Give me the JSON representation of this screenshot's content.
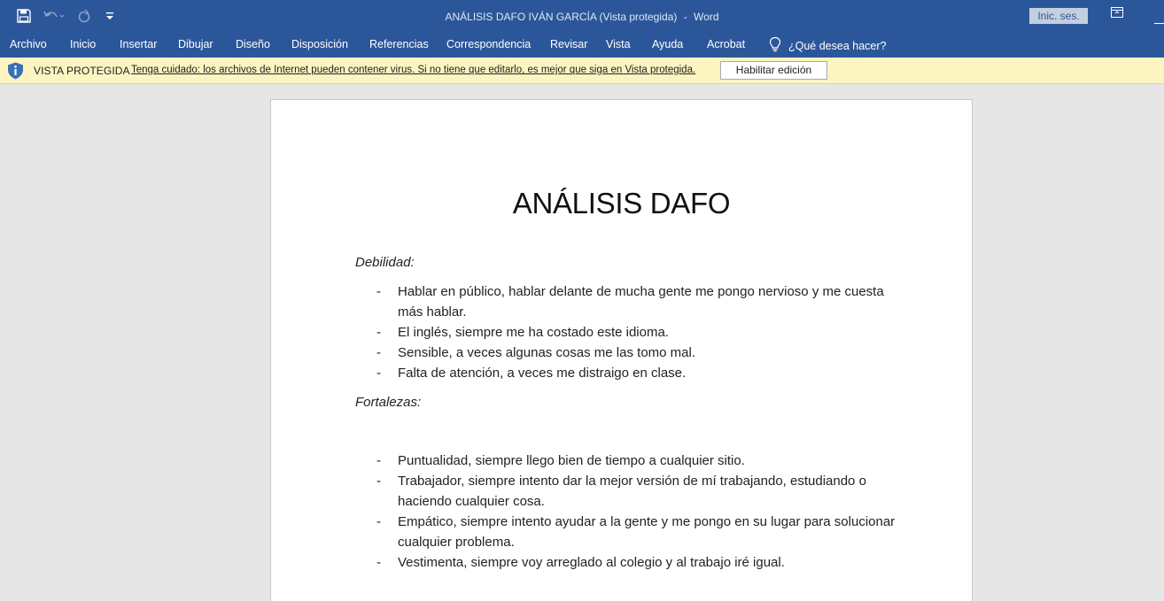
{
  "titlebar": {
    "doc_title": "ANÁLISIS DAFO IVÁN GARCÍA (Vista protegida)",
    "separator": "-",
    "app_name": "Word",
    "signin_label": "Inic. ses."
  },
  "menu": {
    "items": [
      "Archivo",
      "Inicio",
      "Insertar",
      "Dibujar",
      "Diseño",
      "Disposición",
      "Referencias",
      "Correspondencia",
      "Revisar",
      "Vista",
      "Ayuda",
      "Acrobat"
    ],
    "tellme": "¿Qué desea hacer?"
  },
  "protected_view": {
    "title": "VISTA PROTEGIDA",
    "message": "Tenga cuidado: los archivos de Internet pueden contener virus. Si no tiene que editarlo, es mejor que siga en Vista protegida.",
    "button": "Habilitar edición"
  },
  "document": {
    "title": "ANÁLISIS DAFO",
    "sections": [
      {
        "heading": "Debilidad:",
        "items": [
          "Hablar en público, hablar delante de mucha gente me pongo nervioso y me cuesta más hablar.",
          "El inglés, siempre me ha costado este idioma.",
          "Sensible, a veces algunas cosas me las tomo mal.",
          "Falta de atención, a veces me distraigo en clase."
        ]
      },
      {
        "heading": "Fortalezas:",
        "items": [
          "Puntualidad, siempre llego bien de tiempo a cualquier sitio.",
          "Trabajador, siempre intento dar la mejor versión de mí trabajando, estudiando o haciendo cualquier cosa.",
          "Empático, siempre intento ayudar a la gente y me pongo en su lugar para solucionar cualquier problema.",
          "Vestimenta, siempre voy arreglado al colegio y al trabajo iré igual."
        ]
      }
    ],
    "bullet": "-"
  },
  "icons": {
    "save": "save-icon",
    "undo": "undo-icon",
    "redo": "redo-icon",
    "customize": "customize-qat-icon",
    "ribbon_display": "ribbon-display-icon",
    "minimize": "minimize-icon",
    "lightbulb": "lightbulb-icon",
    "shield": "shield-info-icon"
  },
  "colors": {
    "accent": "#2b579a",
    "protected_bar": "#fdf5c1"
  }
}
